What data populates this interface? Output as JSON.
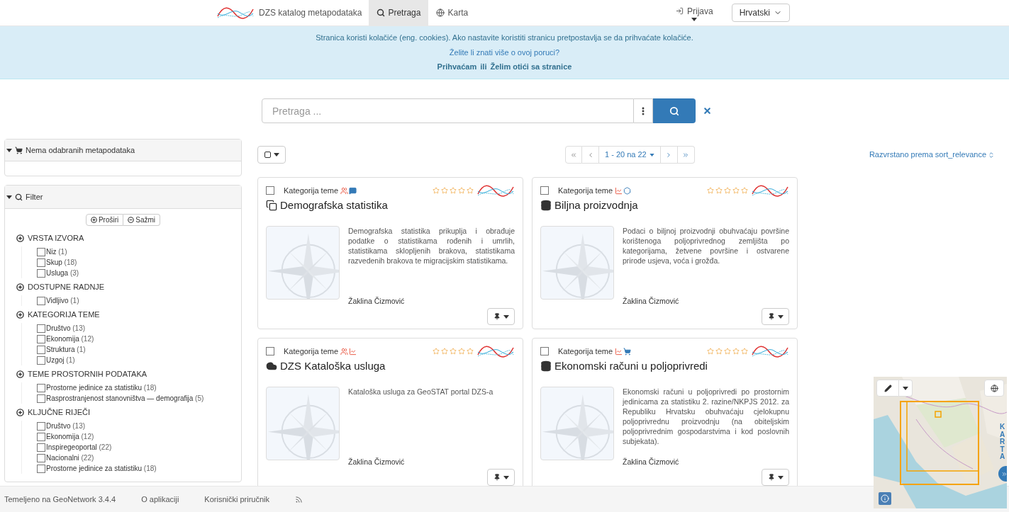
{
  "header": {
    "brand": "DZS katalog metapodataka",
    "tabs": [
      {
        "label": "Pretraga",
        "kind": "search",
        "selected": true
      },
      {
        "label": "Karta",
        "kind": "globe",
        "selected": false
      }
    ],
    "login": "Prijava",
    "language": "Hrvatski"
  },
  "cookie_banner": {
    "message": "Stranica koristi kolačiće (eng. cookies). Ako nastavite koristiti stranicu pretpostavlja se da prihvaćate kolačiće.",
    "more_link": "Želite li znati više o ovoj poruci?",
    "accept": "Prihvaćam",
    "or": "ili",
    "leave": "Želim otići sa stranice"
  },
  "search": {
    "placeholder": "Pretraga ..."
  },
  "selection_panel": {
    "title": "Nema odabranih metapodataka"
  },
  "filter": {
    "title": "Filter",
    "expand_all": "Proširi",
    "collapse_all": "Sažmi",
    "facets": [
      {
        "title": "VRSTA IZVORA",
        "items": [
          {
            "label": "Niz",
            "count": "(1)",
            "checked": false
          },
          {
            "label": "Skup",
            "count": "(18)",
            "checked": false
          },
          {
            "label": "Usluga",
            "count": "(3)",
            "checked": false
          }
        ]
      },
      {
        "title": "DOSTUPNE RADNJE",
        "items": [
          {
            "label": "Vidljivo",
            "count": "(1)",
            "checked": false
          }
        ]
      },
      {
        "title": "KATEGORIJA TEME",
        "items": [
          {
            "label": "Društvo",
            "count": "(13)",
            "checked": false
          },
          {
            "label": "Ekonomija",
            "count": "(12)",
            "checked": false
          },
          {
            "label": "Struktura",
            "count": "(1)",
            "checked": false
          },
          {
            "label": "Uzgoj",
            "count": "(1)",
            "checked": false
          }
        ]
      },
      {
        "title": "TEME PROSTORNIH PODATAKA",
        "items": [
          {
            "label": "Prostorne jedinice za statistiku",
            "count": "(18)",
            "checked": false
          },
          {
            "label": "Rasprostranjenost stanovništva — demografija",
            "count": "(5)",
            "checked": false
          }
        ]
      },
      {
        "title": "KLJUČNE RIJEČI",
        "items": [
          {
            "label": "Društvo",
            "count": "(13)",
            "checked": false
          },
          {
            "label": "Ekonomija",
            "count": "(12)",
            "checked": false
          },
          {
            "label": "Inspiregeoportal",
            "count": "(22)",
            "checked": false
          },
          {
            "label": "Nacionalni",
            "count": "(22)",
            "checked": false
          },
          {
            "label": "Prostorne jedinice za statistiku",
            "count": "(18)",
            "checked": false
          }
        ]
      }
    ]
  },
  "results": {
    "select_all_checked": false,
    "pagination": "1 - 20 na 22",
    "sort": "Razvrstano prema sort_relevance",
    "cards": [
      {
        "category_label": "Kategorija teme",
        "categories": [
          {
            "kind": "society"
          },
          {
            "kind": "communication"
          }
        ],
        "kind": "series",
        "title": "Demografska statistika",
        "description": "Demografska statistika prikuplja i obrađuje podatke o statistikama rođenih i umrlih, statistikama sklopljenih brakova, statistikama razvedenih brakova te migracijskim statistikama.",
        "author": "Žaklina Čizmović",
        "stars": 0,
        "checked": false
      },
      {
        "category_label": "Kategorija teme",
        "categories": [
          {
            "kind": "economy"
          },
          {
            "kind": "structure"
          }
        ],
        "kind": "dataset",
        "title": "Biljna proizvodnja",
        "description": "Podaci o biljnoj proizvodnji obuhvaćaju površine korištenoga poljoprivrednog zemljišta po kategorijama, žetvene površine i ostvarene prirode usjeva, voća i grožđa.",
        "author": "Žaklina Čizmović",
        "stars": 0,
        "checked": false
      },
      {
        "category_label": "Kategorija teme",
        "categories": [
          {
            "kind": "society"
          },
          {
            "kind": "economy"
          }
        ],
        "kind": "service",
        "title": "DZS Kataloška usluga",
        "description": "Kataloška usluga za GeoSTAT portal DZS-a",
        "author": "Žaklina Čizmović",
        "stars": 0,
        "checked": false
      },
      {
        "category_label": "Kategorija teme",
        "categories": [
          {
            "kind": "economy"
          },
          {
            "kind": "farming"
          }
        ],
        "kind": "dataset",
        "title": "Ekonomski računi u poljoprivredi",
        "description": "Ekonomski računi u poljoprivredi po prostornim jedinicama za statistiku 2. razine/NKPJS 2012. za Republiku Hrvatsku obuhvaćaju cjelokupnu poljoprivrednu proizvodnju (na obiteljskim poljoprivrednim gospodarstvima i kod poslovnih subjekata).",
        "author": "Žaklina Čizmović",
        "stars": 0,
        "checked": false
      }
    ]
  },
  "map": {
    "tab": "KARTA"
  },
  "footer": {
    "links": [
      "Temeljeno na GeoNetwork 3.4.4",
      "O aplikaciji",
      "Korisnički priručnik"
    ]
  }
}
